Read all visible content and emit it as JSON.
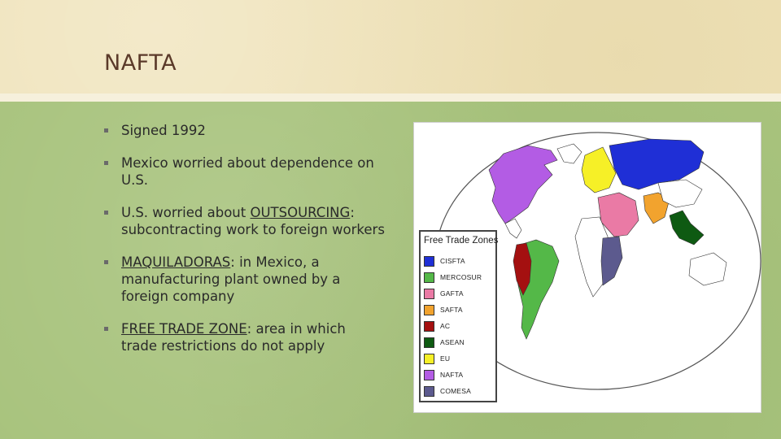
{
  "slide": {
    "title": "NAFTA",
    "bullets": [
      {
        "lead": "Signed 1992",
        "lead_underline": false,
        "rest": ""
      },
      {
        "lead": "Mexico worried about dependence on U.S.",
        "lead_underline": false,
        "rest": ""
      },
      {
        "pre": "U.S. worried about ",
        "lead": "OUTSOURCING",
        "lead_underline": true,
        "rest": ": subcontracting work to foreign workers"
      },
      {
        "lead": "MAQUILADORAS",
        "lead_underline": true,
        "rest": ": in Mexico, a manufacturing plant owned by a foreign company"
      },
      {
        "lead": "FREE TRADE ZONE",
        "lead_underline": true,
        "rest": ": area in which trade restrictions do not apply"
      }
    ]
  },
  "map": {
    "legend_title": "Free Trade Zones",
    "legend": [
      {
        "label": "CISFTA",
        "color": "#1f2fd6"
      },
      {
        "label": "MERCOSUR",
        "color": "#54b848"
      },
      {
        "label": "GAFTA",
        "color": "#ea7aa5"
      },
      {
        "label": "SAFTA",
        "color": "#f2a32e"
      },
      {
        "label": "AC",
        "color": "#a41010"
      },
      {
        "label": "ASEAN",
        "color": "#0e5a12"
      },
      {
        "label": "EU",
        "color": "#f6f027"
      },
      {
        "label": "NAFTA",
        "color": "#b35ce4"
      },
      {
        "label": "COMESA",
        "color": "#5c5a8e"
      }
    ]
  }
}
